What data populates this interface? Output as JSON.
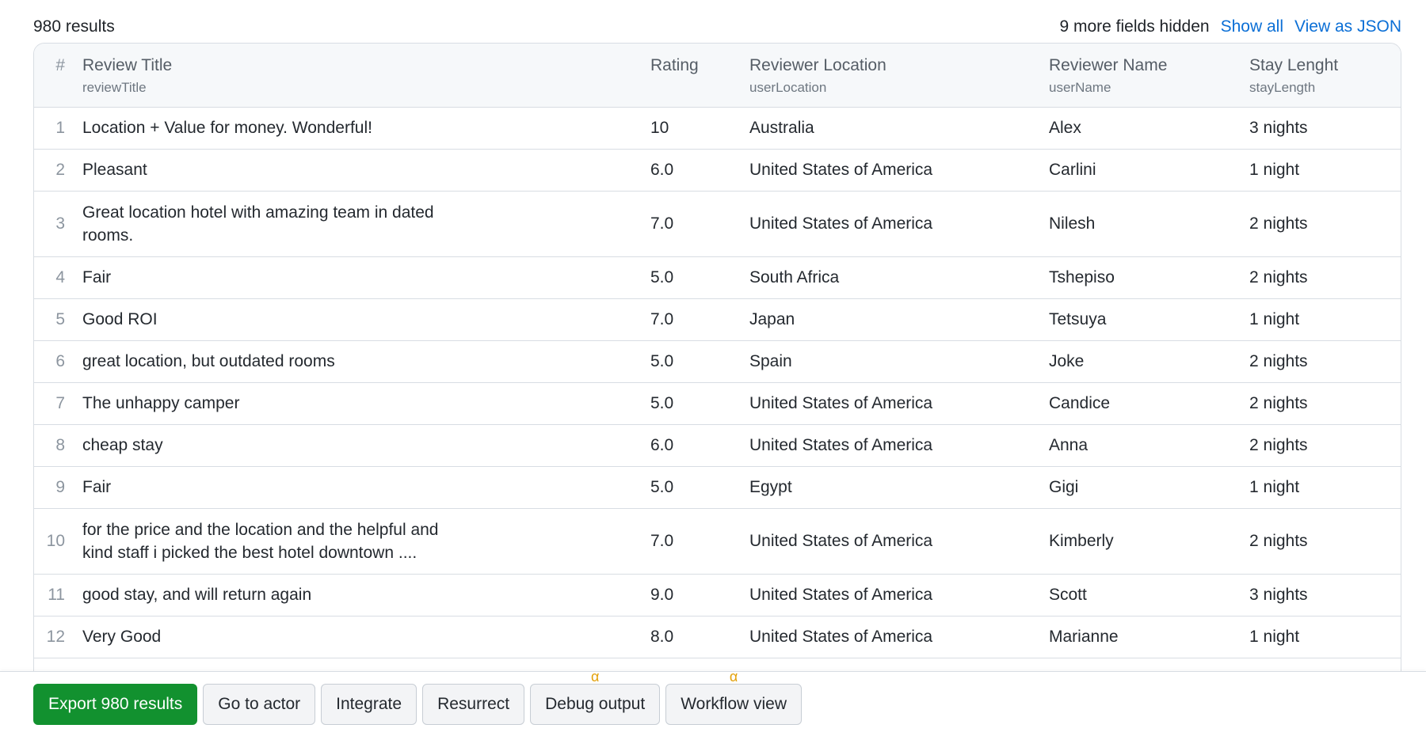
{
  "header": {
    "results_count": "980 results",
    "hidden_fields": "9 more fields hidden",
    "show_all": "Show all",
    "view_json": "View as JSON"
  },
  "columns": [
    {
      "label": "#",
      "api": ""
    },
    {
      "label": "Review Title",
      "api": "reviewTitle"
    },
    {
      "label": "Rating",
      "api": ""
    },
    {
      "label": "Reviewer Location",
      "api": "userLocation"
    },
    {
      "label": "Reviewer Name",
      "api": "userName"
    },
    {
      "label": "Stay Lenght",
      "api": "stayLength"
    }
  ],
  "rows": [
    {
      "n": "1",
      "title": "Location + Value for money. Wonderful!",
      "rating": "10",
      "location": "Australia",
      "name": "Alex",
      "stay": "3 nights"
    },
    {
      "n": "2",
      "title": "Pleasant",
      "rating": "6.0",
      "location": "United States of America",
      "name": "Carlini",
      "stay": "1 night"
    },
    {
      "n": "3",
      "title": "Great location hotel with amazing team in dated rooms.",
      "rating": "7.0",
      "location": "United States of America",
      "name": "Nilesh",
      "stay": "2 nights"
    },
    {
      "n": "4",
      "title": "Fair",
      "rating": "5.0",
      "location": "South Africa",
      "name": "Tshepiso",
      "stay": "2 nights"
    },
    {
      "n": "5",
      "title": "Good ROI",
      "rating": "7.0",
      "location": "Japan",
      "name": "Tetsuya",
      "stay": "1 night"
    },
    {
      "n": "6",
      "title": "great location, but outdated rooms",
      "rating": "5.0",
      "location": "Spain",
      "name": "Joke",
      "stay": "2 nights"
    },
    {
      "n": "7",
      "title": "The unhappy camper",
      "rating": "5.0",
      "location": "United States of America",
      "name": "Candice",
      "stay": "2 nights"
    },
    {
      "n": "8",
      "title": "cheap stay",
      "rating": "6.0",
      "location": "United States of America",
      "name": "Anna",
      "stay": "2 nights"
    },
    {
      "n": "9",
      "title": "Fair",
      "rating": "5.0",
      "location": "Egypt",
      "name": "Gigi",
      "stay": "1 night"
    },
    {
      "n": "10",
      "title": "for the price and the location and the helpful and kind staff i picked the best hotel downtown ....",
      "rating": "7.0",
      "location": "United States of America",
      "name": "Kimberly",
      "stay": "2 nights"
    },
    {
      "n": "11",
      "title": "good stay, and will return again",
      "rating": "9.0",
      "location": "United States of America",
      "name": "Scott",
      "stay": "3 nights"
    },
    {
      "n": "12",
      "title": "Very Good",
      "rating": "8.0",
      "location": "United States of America",
      "name": "Marianne",
      "stay": "1 night"
    }
  ],
  "footer": {
    "export": "Export 980 results",
    "go_to_actor": "Go to actor",
    "integrate": "Integrate",
    "resurrect": "Resurrect",
    "debug_output": "Debug output",
    "workflow_view": "Workflow view",
    "alpha_badge": "α",
    "accent_color": "#12912f"
  }
}
